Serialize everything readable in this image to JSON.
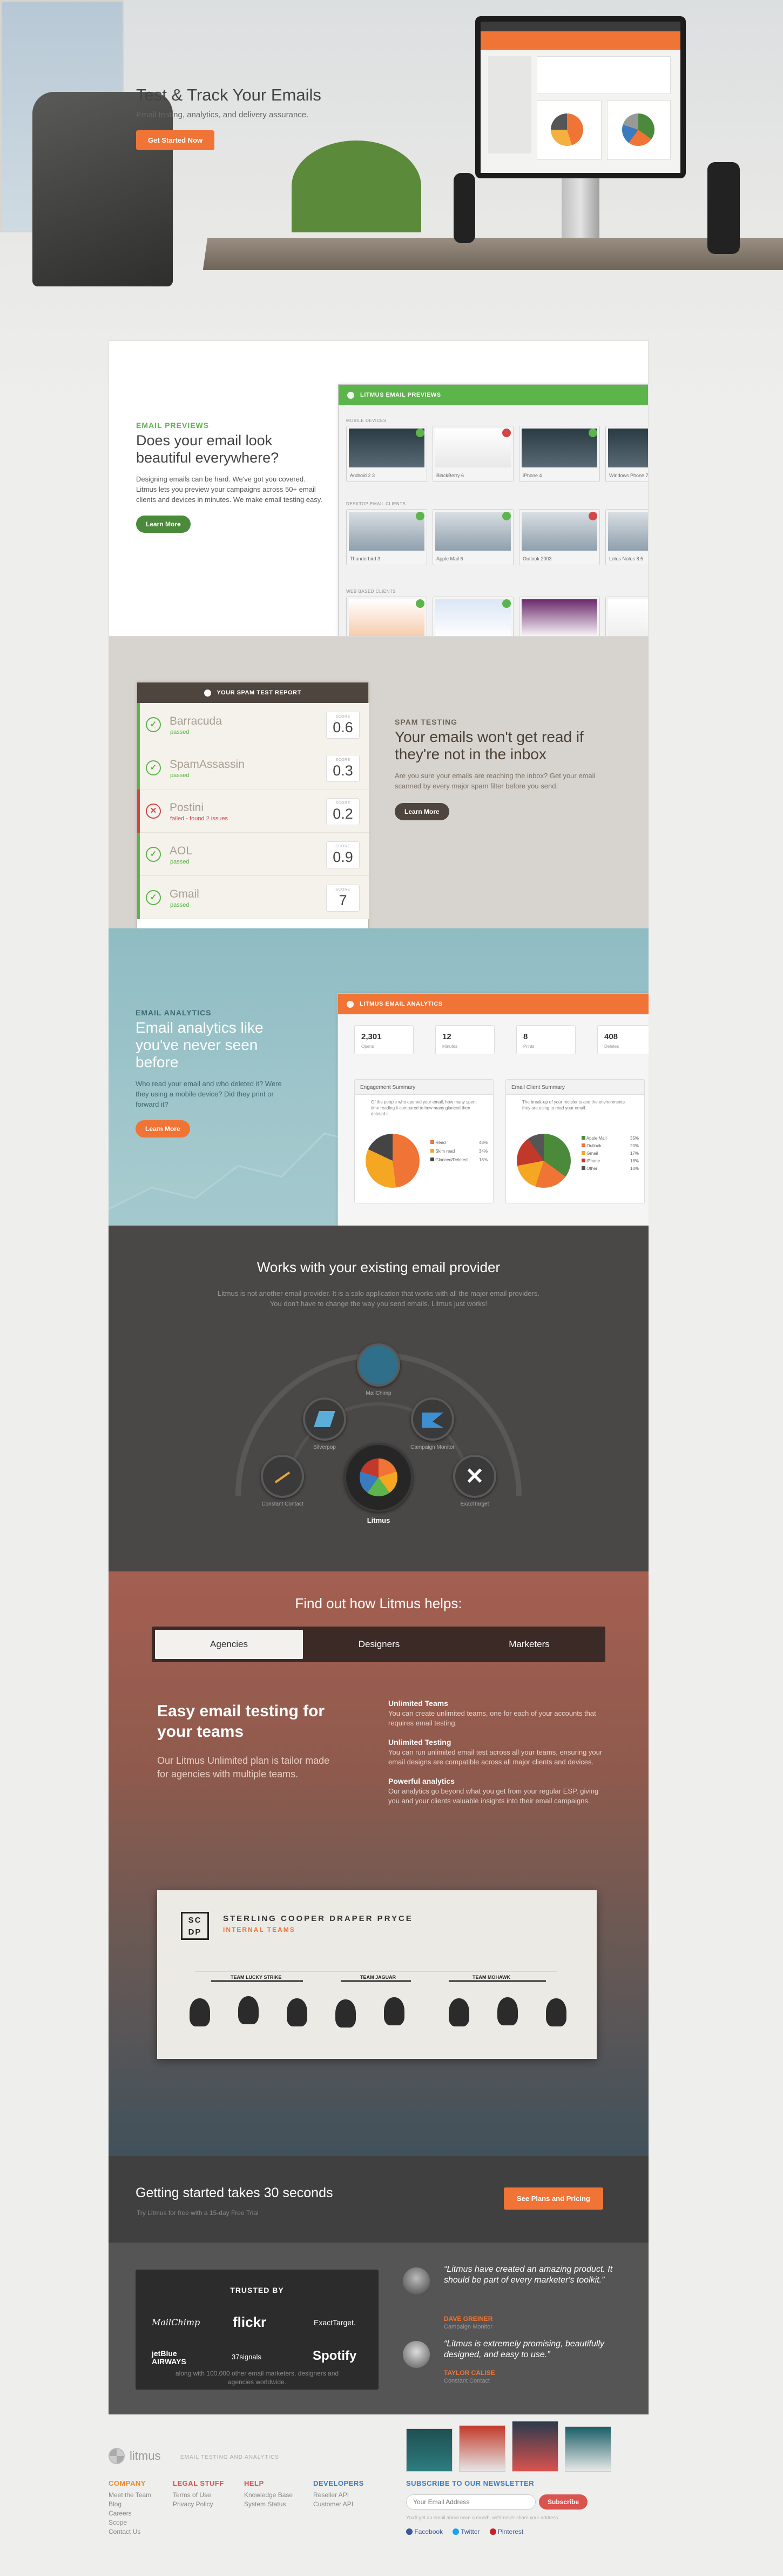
{
  "hero": {
    "title": "Test & Track Your Emails",
    "subtitle": "Email testing, analytics, and delivery assurance.",
    "cta": "Get Started Now"
  },
  "previews": {
    "kicker": "Email Previews",
    "title": "Does your email look beautiful everywhere?",
    "body": "Designing emails can be hard. We've got you covered. Litmus lets you preview your campaigns across 50+ email clients and devices in minutes. We make email testing easy.",
    "cta": "Learn More",
    "panel_title": "LITMUS EMAIL PREVIEWS",
    "groups": [
      "MOBILE DEVICES",
      "DESKTOP EMAIL CLIENTS",
      "WEB BASED CLIENTS"
    ],
    "mobile": [
      "Android 2.3",
      "BlackBerry 6",
      "iPhone 4",
      "Windows Phone 7"
    ],
    "desktop": [
      "Thunderbird 3",
      "Apple Mail 6",
      "Outlook 2003",
      "Lotus Notes 8.5"
    ]
  },
  "spam": {
    "panel_title": "YOUR SPAM TEST REPORT",
    "score_label": "SCORE",
    "rows": [
      {
        "name": "Barracuda",
        "status": "passed",
        "score": "0.6"
      },
      {
        "name": "SpamAssassin",
        "status": "passed",
        "score": "0.3"
      },
      {
        "name": "Postini",
        "status": "failed - found 2 issues",
        "score": "0.2"
      },
      {
        "name": "AOL",
        "status": "passed",
        "score": "0.9"
      },
      {
        "name": "Gmail",
        "status": "passed",
        "score": "7"
      }
    ],
    "kicker": "Spam Testing",
    "title": "Your emails won't get read if they're not in the inbox",
    "body": "Are you sure your emails are reaching the inbox? Get your email scanned by every major spam filter before you send.",
    "cta": "Learn More"
  },
  "analytics": {
    "kicker": "Email Analytics",
    "title": "Email analytics like you've never seen before",
    "body": "Who read your email and who deleted it? Were they using a mobile device? Did they print or forward it?",
    "cta": "Learn More",
    "panel_title": "LITMUS EMAIL ANALYTICS",
    "stats": [
      {
        "value": "2,301",
        "label": "Opens"
      },
      {
        "value": "12",
        "label": "Minutes"
      },
      {
        "value": "8",
        "label": "Prints"
      },
      {
        "value": "408",
        "label": "Deletes"
      }
    ],
    "card1": {
      "title": "Engagement Summary",
      "note": "Of the people who opened your email, how many spent time reading it compared to how many glanced then deleted it.",
      "legend": [
        "Read",
        "Skim read",
        "Glanced/Deleted"
      ],
      "pct": [
        "48%",
        "34%",
        "18%"
      ]
    },
    "card2": {
      "title": "Email Client Summary",
      "note": "The break-up of your recipients and the environments they are using to read your email.",
      "legend": [
        "Apple Mail",
        "Outlook",
        "Gmail",
        "iPhone",
        "Other"
      ],
      "pct": [
        "35%",
        "20%",
        "17%",
        "18%",
        "10%"
      ]
    }
  },
  "providers": {
    "title": "Works with your existing email provider",
    "body": "Litmus is not another email provider. It is a solo application that works with all the major email providers. You don't have to change the way you send emails. Litmus just works!",
    "items": [
      "MailChimp",
      "Silverpop",
      "Campaign Monitor",
      "Constant Contact",
      "ExactTarget"
    ],
    "center": "Litmus"
  },
  "helps": {
    "title": "Find out how Litmus helps:",
    "tabs": [
      "Agencies",
      "Designers",
      "Marketers"
    ],
    "heading": "Easy email testing for your teams",
    "body": "Our Litmus Unlimited plan is tailor made for agencies with multiple teams.",
    "features": [
      {
        "title": "Unlimited Teams",
        "text": "You can create unlimited teams, one for each of your accounts that requires email testing."
      },
      {
        "title": "Unlimited Testing",
        "text": "You can run unlimited email test across all your teams, ensuring your email designs are compatible across all major clients and devices."
      },
      {
        "title": "Powerful analytics",
        "text": "Our analytics go beyond what you get from your regular ESP, giving you and your clients valuable insights into their email campaigns."
      }
    ],
    "agency_logo": "SC DP",
    "agency_name": "STERLING COOPER DRAPER PRYCE",
    "agency_sub": "INTERNAL TEAMS",
    "teams": [
      "TEAM LUCKY STRIKE",
      "TEAM JAGUAR",
      "TEAM MOHAWK"
    ]
  },
  "getting_started": {
    "title": "Getting started takes 30 seconds",
    "sub": "Try Litmus for free with a 15-day Free Trial",
    "cta": "See Plans and Pricing"
  },
  "trusted": {
    "title": "TRUSTED BY",
    "logos": [
      "MailChimp",
      "flickr",
      "ExactTarget.",
      "jetBlue AIRWAYS",
      "37signals",
      "Spotify"
    ],
    "note": "along with 100,000 other email marketers, designers and agencies worldwide.",
    "quotes": [
      {
        "text": "“Litmus have created an amazing product. It should be part of every marketer's toolkit.”",
        "name": "DAVE GREINER",
        "role": "Campaign Monitor"
      },
      {
        "text": "“Litmus is extremely promising, beautifully designed, and easy to use.”",
        "name": "TAYLOR CALISE",
        "role": "Constant Contact"
      }
    ]
  },
  "footer": {
    "logo": "litmus",
    "tagline": "EMAIL TESTING AND ANALYTICS",
    "cols": [
      {
        "title": "COMPANY",
        "color": "#ef8a2c",
        "links": [
          "Meet the Team",
          "Blog",
          "Careers",
          "Scope",
          "Contact Us"
        ]
      },
      {
        "title": "LEGAL STUFF",
        "color": "#d9534f",
        "links": [
          "Terms of Use",
          "Privacy Policy"
        ]
      },
      {
        "title": "HELP",
        "color": "#d9534f",
        "links": [
          "Knowledge Base",
          "System Status"
        ]
      },
      {
        "title": "DEVELOPERS",
        "color": "#3a7bbf",
        "links": [
          "Reseller API",
          "Customer API"
        ]
      }
    ],
    "newsletter_title": "SUBSCRIBE TO OUR NEWSLETTER",
    "email_placeholder": "Your Email Address",
    "subscribe": "Subscribe",
    "fineprint": "You'll get an email about once a month, we'll never share your address.",
    "social": [
      "Facebook",
      "Twitter",
      "Pinterest"
    ]
  }
}
